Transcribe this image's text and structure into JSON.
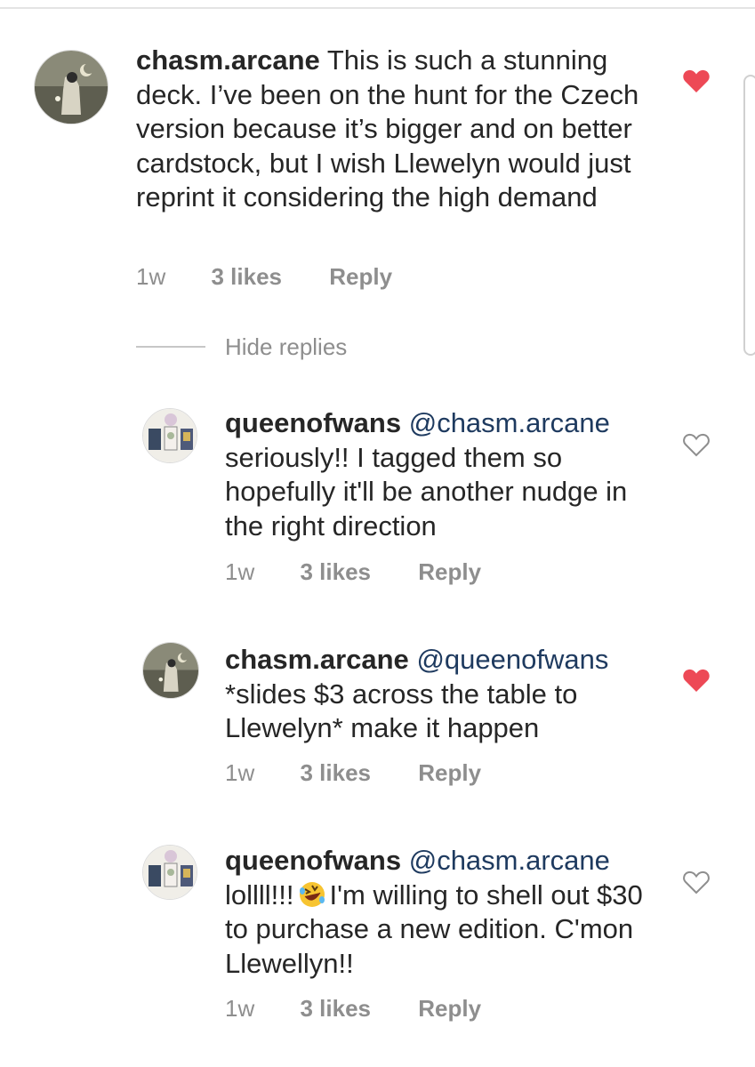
{
  "comments": [
    {
      "username": "chasm.arcane",
      "mention": "",
      "text": "This is such a stunning deck. I’ve been on the hunt for the Czech version because it’s bigger and on better cardstock, but I wish Llewelyn would just reprint it considering the high demand",
      "time": "1w",
      "likes": "3 likes",
      "reply": "Reply",
      "liked": true
    },
    {
      "username": "queenofwans",
      "mention": "@chasm.arcane",
      "text": "seriously!! I tagged them so hopefully it'll be another nudge in the right direction",
      "time": "1w",
      "likes": "3 likes",
      "reply": "Reply",
      "liked": false
    },
    {
      "username": "chasm.arcane",
      "mention": "@queenofwans",
      "text": "*slides $3 across the table to Llewelyn* make it happen",
      "time": "1w",
      "likes": "3 likes",
      "reply": "Reply",
      "liked": true
    },
    {
      "username": "queenofwans",
      "mention": "@chasm.arcane",
      "text_before_emoji": "lollll!!!",
      "emoji": "rolling-on-floor-laughing-emoji",
      "text_after_emoji": "I'm willing to shell out $30 to purchase a new edition. C'mon Llewellyn!!",
      "time": "1w",
      "likes": "3 likes",
      "reply": "Reply",
      "liked": false
    }
  ],
  "hide_replies": "Hide replies",
  "colors": {
    "liked_heart": "#ed4956",
    "unliked_heart": "#8e8e8e",
    "mention": "#1e3a5f",
    "meta": "#8e8e8e"
  }
}
